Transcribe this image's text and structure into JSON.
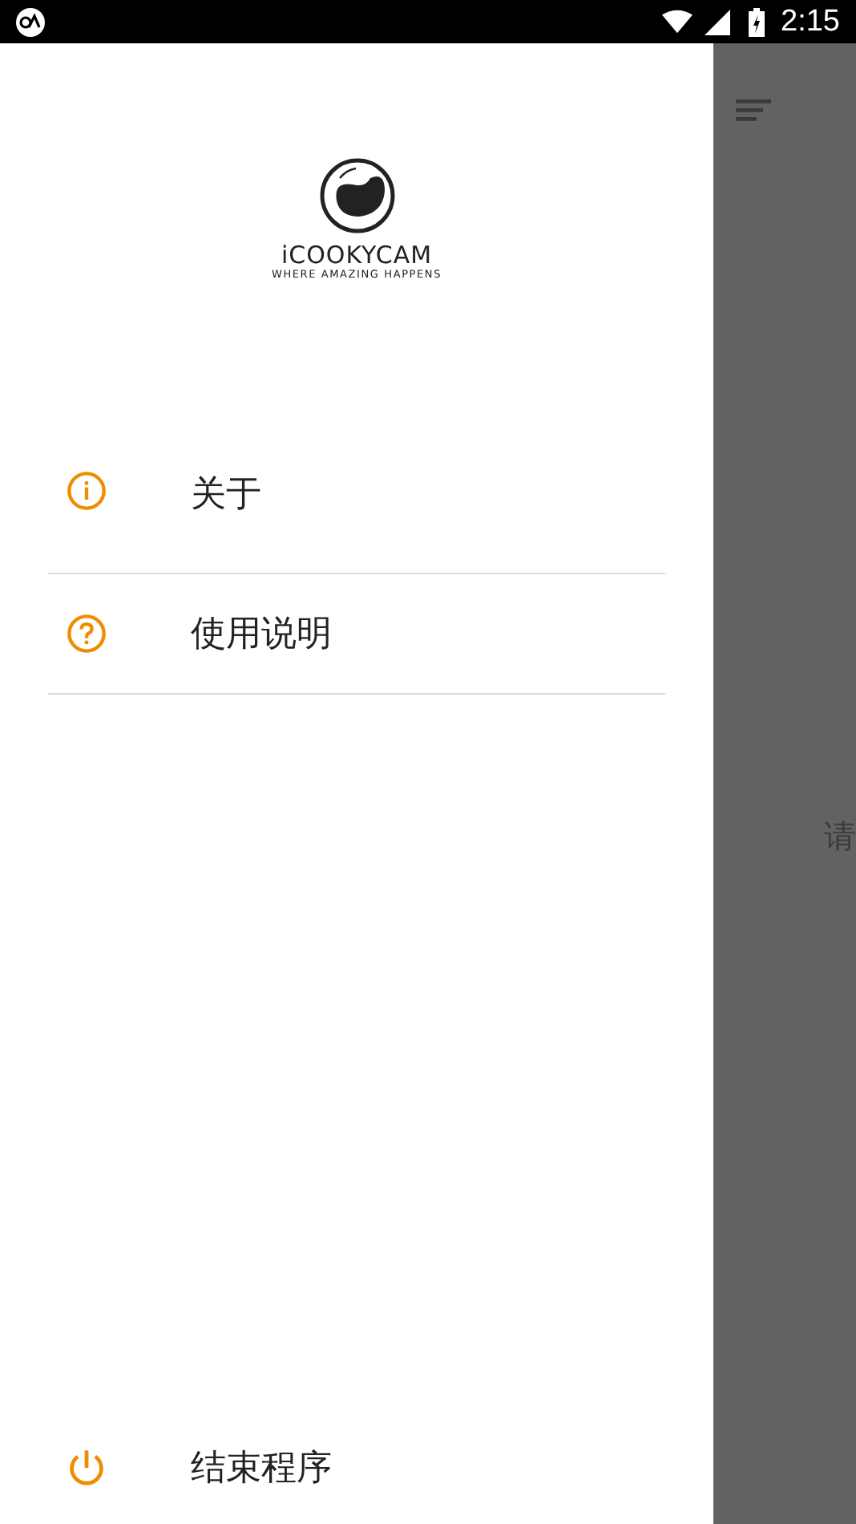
{
  "status_bar": {
    "time": "2:15"
  },
  "logo": {
    "name": "iCOOKYCAM",
    "tagline": "WHERE AMAZING HAPPENS"
  },
  "menu": [
    {
      "kind": "info",
      "label": "关于"
    },
    {
      "kind": "help",
      "label": "使用说明"
    }
  ],
  "footer_item": {
    "kind": "power",
    "label": "结束程序"
  },
  "background": {
    "text": "请"
  }
}
